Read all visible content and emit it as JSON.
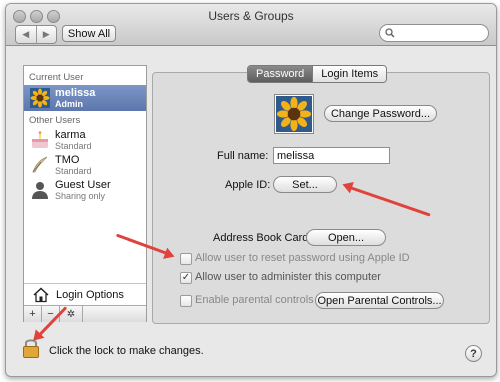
{
  "window": {
    "title": "Users & Groups"
  },
  "toolbar": {
    "back": "◀",
    "forward": "▶",
    "show_all": "Show All",
    "search_placeholder": ""
  },
  "sidebar": {
    "current_user_heading": "Current User",
    "other_users_heading": "Other Users",
    "current_user": {
      "name": "melissa",
      "role": "Admin"
    },
    "other_users": [
      {
        "name": "karma",
        "role": "Standard"
      },
      {
        "name": "TMO",
        "role": "Standard"
      },
      {
        "name": "Guest User",
        "role": "Sharing only"
      }
    ],
    "login_options": "Login Options",
    "add": "+",
    "remove": "−",
    "action": "✲"
  },
  "tabs": [
    {
      "label": "Password",
      "active": true
    },
    {
      "label": "Login Items",
      "active": false
    }
  ],
  "password_pane": {
    "change_password": "Change Password...",
    "full_name_label": "Full name:",
    "full_name_value": "melissa",
    "apple_id_label": "Apple ID:",
    "apple_id_button": "Set...",
    "address_book_label": "Address Book Card:",
    "address_book_button": "Open...",
    "checkboxes": [
      {
        "label": "Allow user to reset password using Apple ID",
        "checked": false
      },
      {
        "label": "Allow user to administer this computer",
        "checked": true
      },
      {
        "label": "Enable parental controls",
        "checked": false
      }
    ],
    "parental_controls_button": "Open Parental Controls..."
  },
  "footer": {
    "lock_text": "Click the lock to make changes.",
    "help": "?"
  },
  "colors": {
    "selection": "#5c77ad",
    "annotation_arrow": "#e0433c"
  }
}
